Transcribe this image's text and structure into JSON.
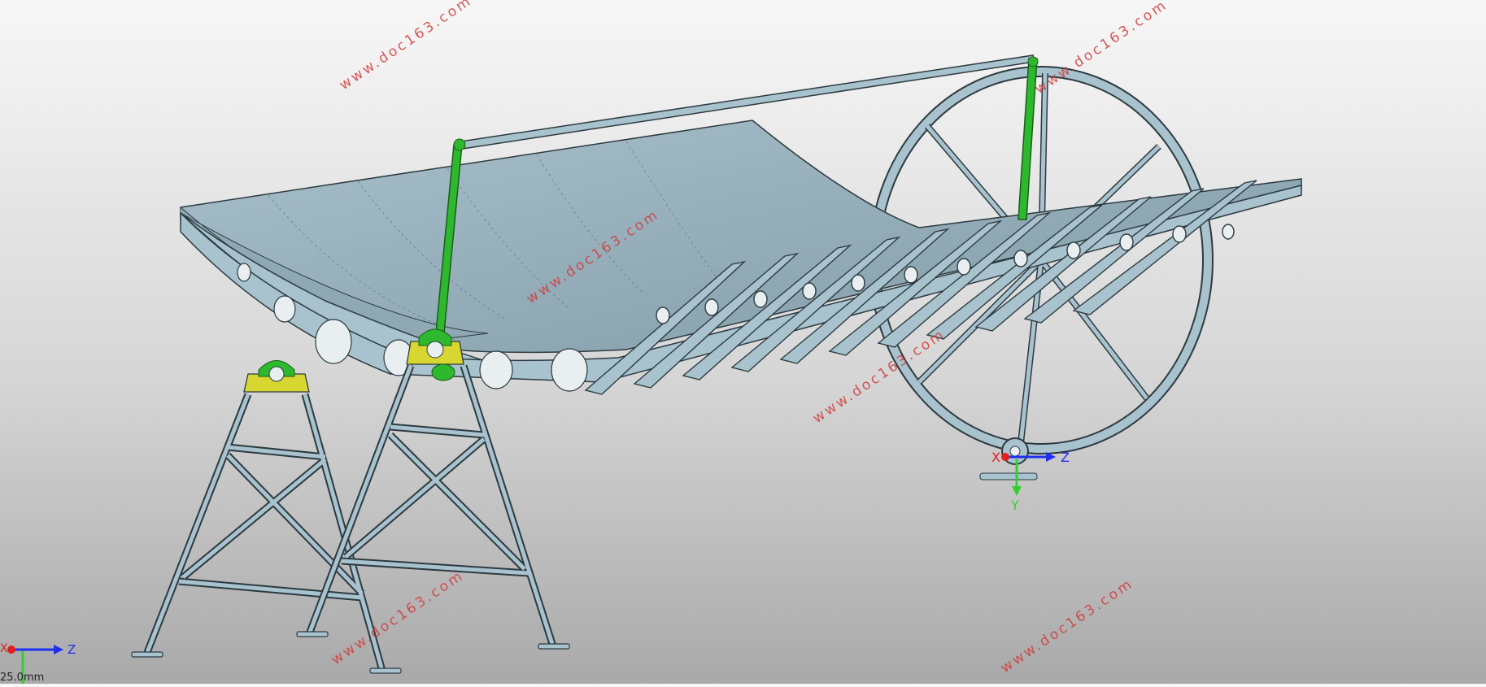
{
  "watermark": "www.doc163.com",
  "scale_label": "25.0mm",
  "triad_main": {
    "x": "X",
    "y": "Y",
    "z": "Z"
  },
  "triad_corner": {
    "x": "X",
    "z": "Z"
  },
  "colors": {
    "part_face": "#9fb8c4",
    "part_edge": "#2d3a40",
    "link_green": "#2db82d",
    "bearing_yellow": "#d8d630",
    "watermark_red": "#d23b3b"
  }
}
